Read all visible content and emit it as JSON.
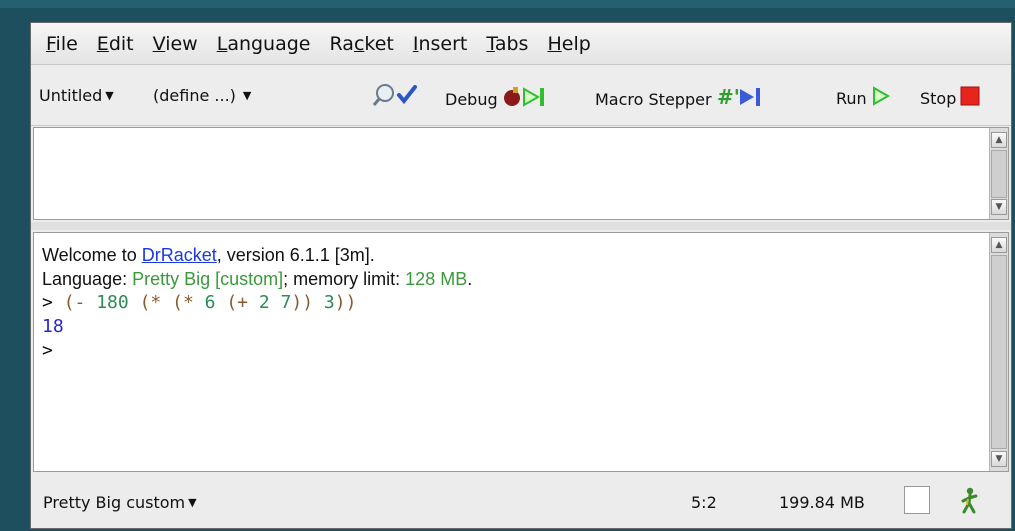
{
  "menubar": {
    "items": [
      {
        "pre": "",
        "key": "F",
        "post": "ile"
      },
      {
        "pre": "",
        "key": "E",
        "post": "dit"
      },
      {
        "pre": "",
        "key": "V",
        "post": "iew"
      },
      {
        "pre": "",
        "key": "L",
        "post": "anguage"
      },
      {
        "pre": "Ra",
        "key": "c",
        "post": "ket"
      },
      {
        "pre": "",
        "key": "I",
        "post": "nsert"
      },
      {
        "pre": "",
        "key": "T",
        "post": "abs"
      },
      {
        "pre": "",
        "key": "H",
        "post": "elp"
      }
    ]
  },
  "toolbar": {
    "file_menu_label": "Untitled",
    "define_menu_label": "(define ...)",
    "debug_label": "Debug",
    "macro_stepper_label": "Macro Stepper",
    "run_label": "Run",
    "stop_label": "Stop"
  },
  "repl": {
    "welcome_pre": "Welcome to ",
    "welcome_link": "DrRacket",
    "welcome_post": ", version 6.1.1 [3m].",
    "lang_pre": "Language: ",
    "lang_name": "Pretty Big [custom]",
    "lang_mid": "; memory limit: ",
    "lang_mem": "128 MB",
    "lang_post": ".",
    "prompt": ">",
    "expr_tokens": [
      {
        "t": "(",
        "c": "paren"
      },
      {
        "t": "- ",
        "c": "paren"
      },
      {
        "t": "180",
        "c": "num"
      },
      {
        "t": " (",
        "c": "paren"
      },
      {
        "t": "* ",
        "c": "paren"
      },
      {
        "t": "(",
        "c": "paren"
      },
      {
        "t": "* ",
        "c": "paren"
      },
      {
        "t": "6",
        "c": "num"
      },
      {
        "t": " (",
        "c": "paren"
      },
      {
        "t": "+ ",
        "c": "paren"
      },
      {
        "t": "2",
        "c": "num"
      },
      {
        "t": " ",
        "c": "paren"
      },
      {
        "t": "7",
        "c": "num"
      },
      {
        "t": ")) ",
        "c": "paren"
      },
      {
        "t": "3",
        "c": "num"
      },
      {
        "t": "))",
        "c": "paren"
      }
    ],
    "result": "18",
    "prompt2": ">"
  },
  "statusbar": {
    "language": "Pretty Big custom",
    "position": "5:2",
    "memory": "199.84 MB"
  },
  "colors": {
    "link": "#1a3ae0",
    "lang_green": "#3a9a3a",
    "paren": "#8b5a2b",
    "number": "#2e8b57",
    "result_blue": "#2828c8",
    "run_green": "#2fbf2f",
    "stop_red": "#e8251c"
  },
  "icons": [
    "magnifier-check-icon",
    "debug-icon",
    "macro-stepper-icon",
    "run-icon",
    "stop-icon",
    "walker-icon"
  ]
}
